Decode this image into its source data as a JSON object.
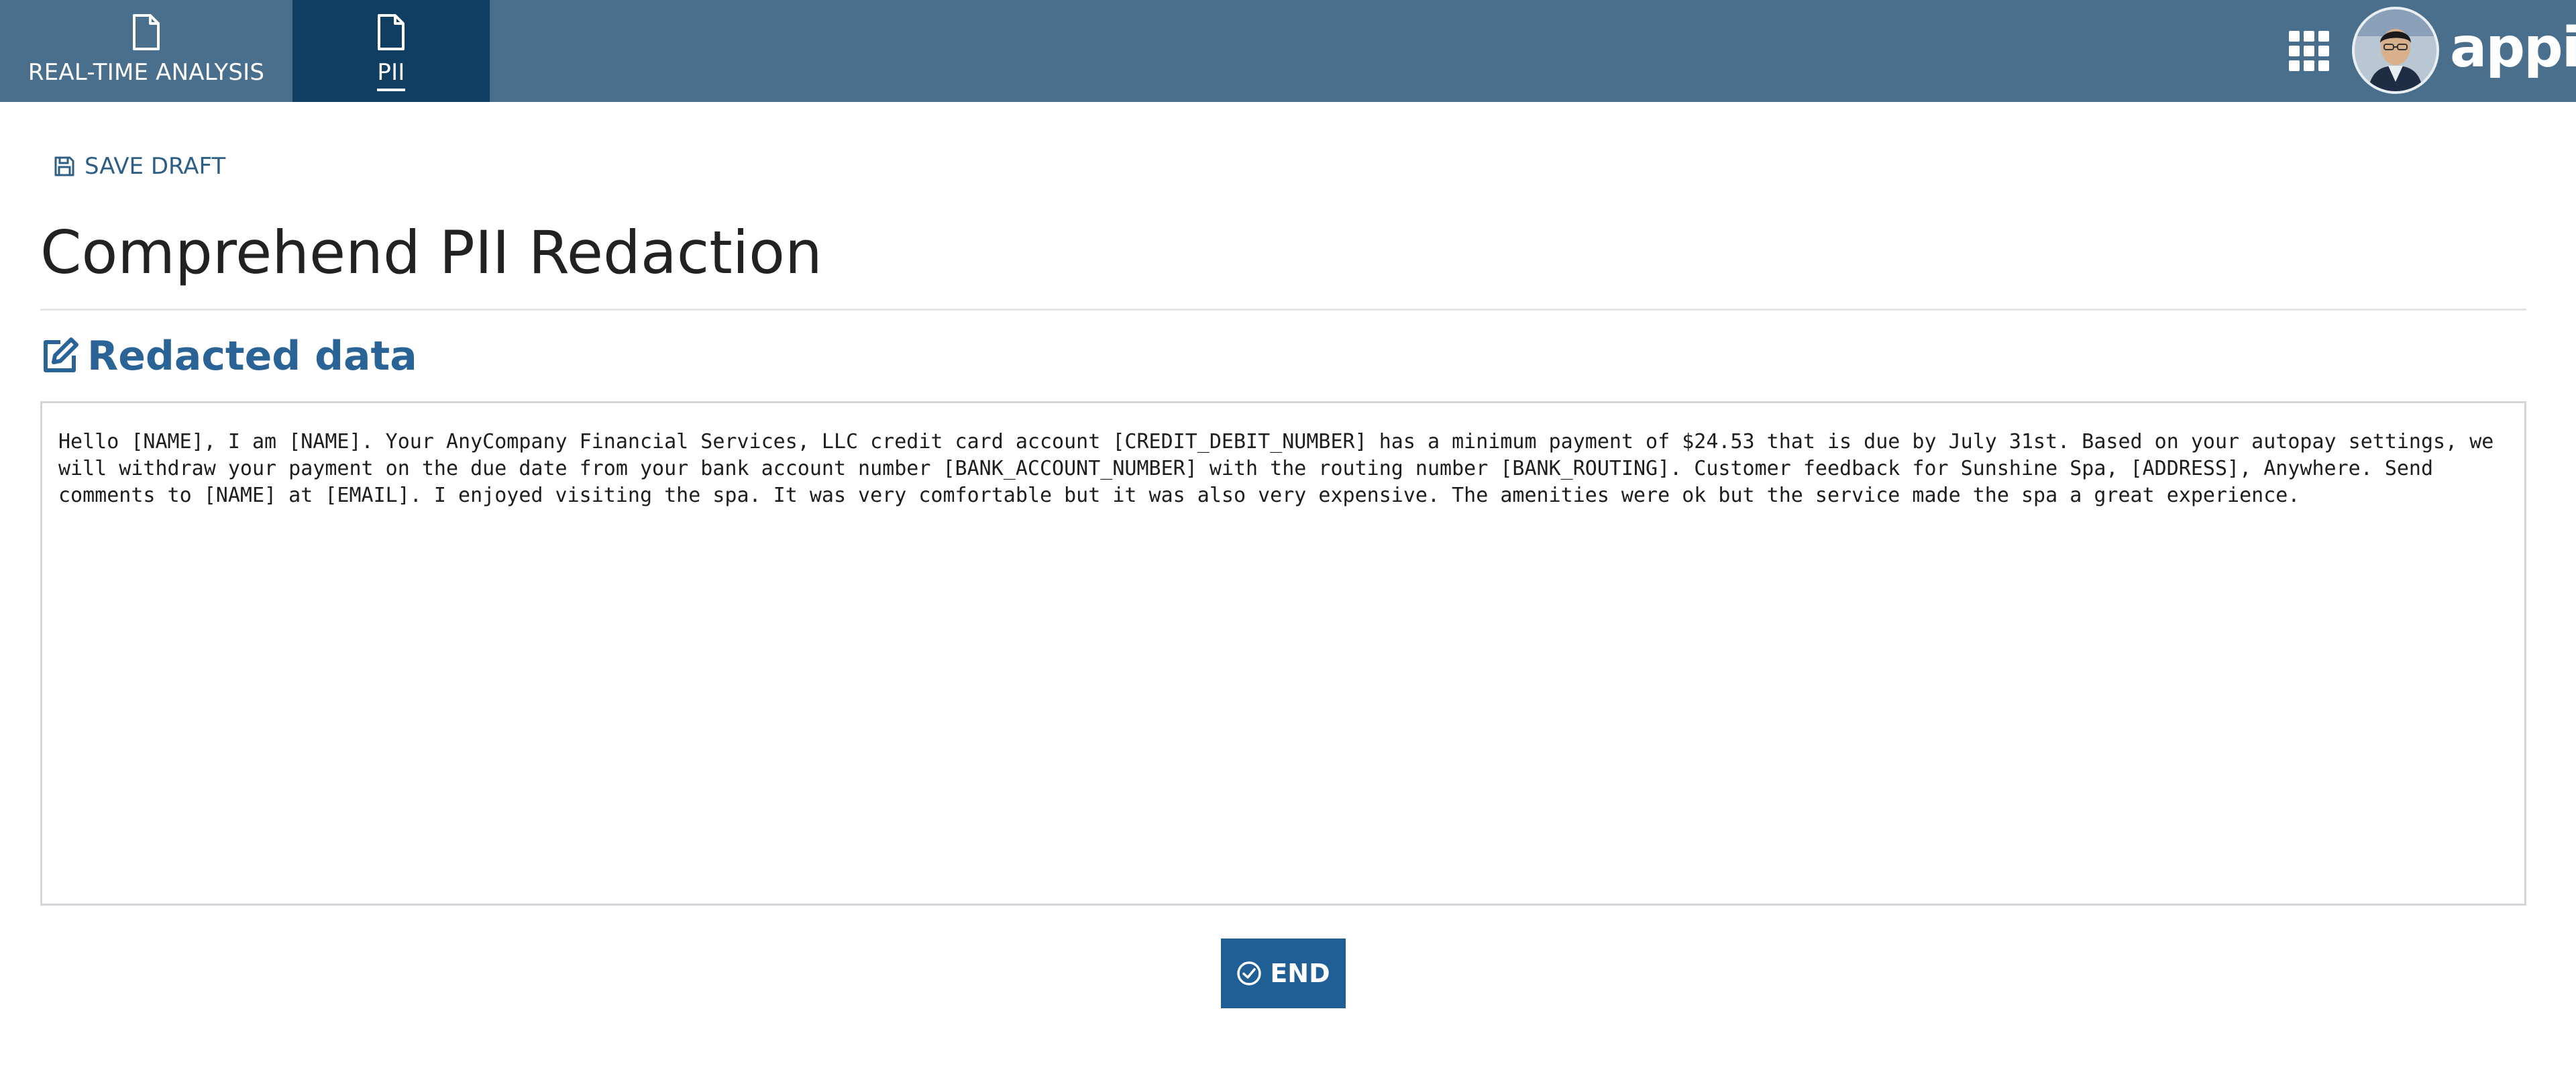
{
  "nav": {
    "tabs": [
      {
        "label": "REAL-TIME ANALYSIS",
        "icon": "document-icon",
        "active": false
      },
      {
        "label": "PII",
        "icon": "document-icon",
        "active": true
      }
    ]
  },
  "header": {
    "brand": "appian",
    "apps_icon": "grid-icon",
    "avatar": "user-avatar"
  },
  "toolbar": {
    "save_draft_label": "SAVE DRAFT",
    "save_icon": "save-icon"
  },
  "page": {
    "title": "Comprehend PII Redaction"
  },
  "section": {
    "heading": "Redacted data",
    "icon": "edit-icon"
  },
  "redacted_text": {
    "value": "Hello [NAME], I am [NAME]. Your AnyCompany Financial Services, LLC credit card account [CREDIT_DEBIT_NUMBER] has a minimum payment of $24.53 that is due by July 31st. Based on your autopay settings, we will withdraw your payment on the due date from your bank account number [BANK_ACCOUNT_NUMBER] with the routing number [BANK_ROUTING]. Customer feedback for Sunshine Spa, [ADDRESS], Anywhere. Send comments to [NAME] at [EMAIL]. I enjoyed visiting the spa. It was very comfortable but it was also very expensive. The amenities were ok but the service made the spa a great experience."
  },
  "actions": {
    "end_label": "END",
    "end_icon": "check-circle-icon"
  },
  "colors": {
    "header_bg": "#4a6f8c",
    "active_tab_bg": "#0f3e62",
    "accent": "#2a6496",
    "button_bg": "#1f5f96"
  }
}
